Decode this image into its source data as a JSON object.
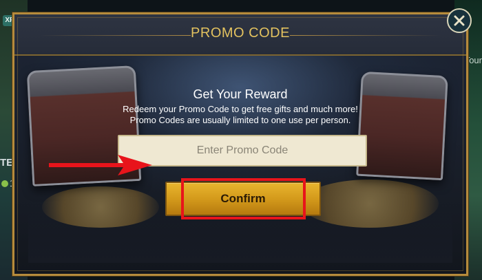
{
  "background": {
    "left_badge": "XP",
    "left_text": "TED",
    "left_count": "1",
    "right_text": "Tour"
  },
  "dialog": {
    "title": "PROMO CODE",
    "reward_title": "Get Your Reward",
    "description_line1": "Redeem your Promo Code to get free gifts and much more!",
    "description_line2": "Promo Codes are usually limited to one use per person.",
    "input": {
      "placeholder": "Enter Promo Code",
      "value": ""
    },
    "confirm_label": "Confirm"
  },
  "colors": {
    "title_gold": "#e3c25f",
    "button_gold": "#d49a1b",
    "annotation_red": "#e8141b",
    "input_bg": "#efe8d2"
  },
  "icons": {
    "close": "close-icon",
    "annotation_arrow": "arrow-right-icon"
  }
}
